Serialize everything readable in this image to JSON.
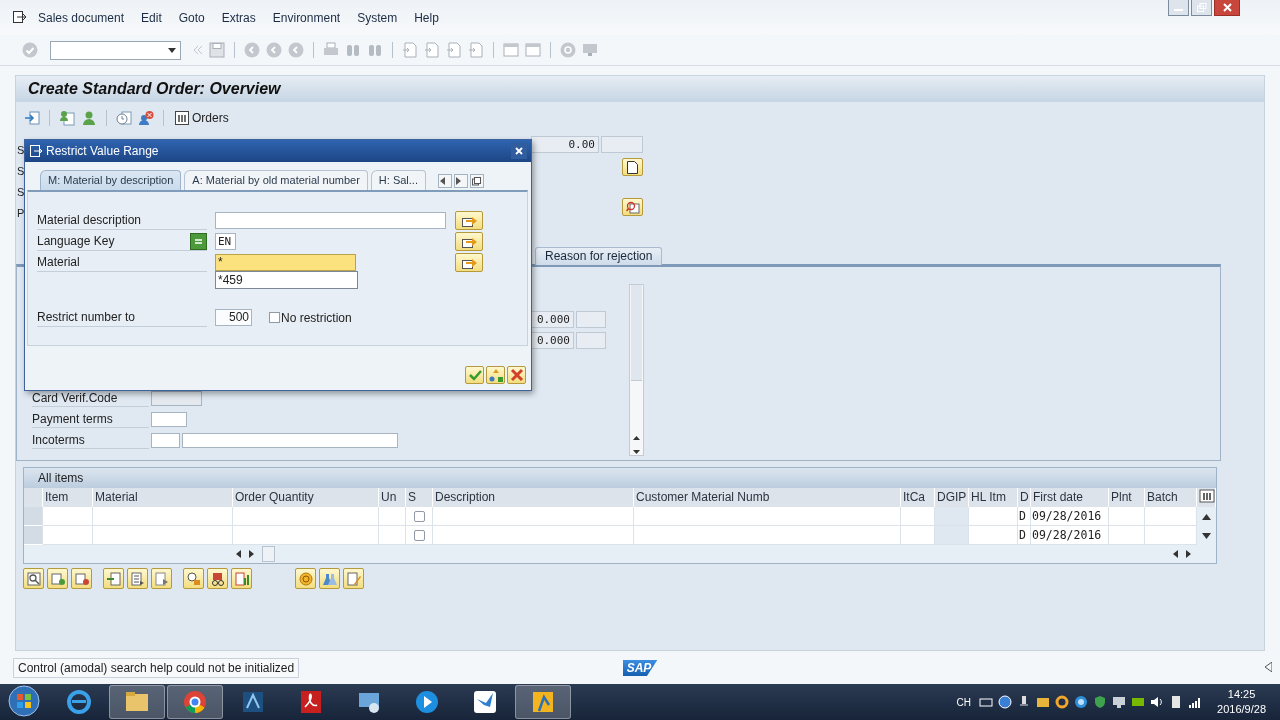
{
  "menu_bar": {
    "items": [
      {
        "label": "Sales document"
      },
      {
        "label": "Edit"
      },
      {
        "label": "Goto"
      },
      {
        "label": "Extras"
      },
      {
        "label": "Environment"
      },
      {
        "label": "System"
      },
      {
        "label": "Help"
      }
    ]
  },
  "screen": {
    "title": "Create Standard Order: Overview",
    "orders_button": "Orders"
  },
  "header": {
    "label_slivers": [
      "S",
      "S",
      "S",
      "P"
    ],
    "net_value": "0.00"
  },
  "tabs": [
    {
      "label": "Reason for rejection",
      "selected": false
    }
  ],
  "tab_panel": {
    "quantities": [
      "0.000",
      "0.000"
    ],
    "form": [
      {
        "label": "Card Verif.Code",
        "kind": "readonly"
      },
      {
        "label": "Payment terms",
        "kind": "single"
      },
      {
        "label": "Incoterms",
        "kind": "double"
      }
    ]
  },
  "items_table": {
    "title": "All items",
    "columns": [
      {
        "label": "Item",
        "kind": "text"
      },
      {
        "label": "Material",
        "kind": "text"
      },
      {
        "label": "Order Quantity",
        "kind": "text"
      },
      {
        "label": "Un",
        "kind": "text"
      },
      {
        "label": "S",
        "kind": "check"
      },
      {
        "label": "Description",
        "kind": "text"
      },
      {
        "label": "Customer Material Numb",
        "kind": "text"
      },
      {
        "label": "ItCa",
        "kind": "text"
      },
      {
        "label": "DGIP",
        "kind": "shaded"
      },
      {
        "label": "HL Itm",
        "kind": "text"
      },
      {
        "label": "D",
        "kind": "text"
      },
      {
        "label": "First date",
        "kind": "text"
      },
      {
        "label": "Plnt",
        "kind": "text"
      },
      {
        "label": "Batch",
        "kind": "text"
      }
    ],
    "rows": [
      {
        "checked": false,
        "cells": [
          "",
          "",
          "",
          "",
          "",
          "",
          "",
          "",
          "",
          "",
          "D",
          "09/28/2016",
          "",
          ""
        ]
      },
      {
        "checked": false,
        "cells": [
          "",
          "",
          "",
          "",
          "",
          "",
          "",
          "",
          "",
          "",
          "D",
          "09/28/2016",
          "",
          ""
        ]
      }
    ]
  },
  "status_bar": {
    "message": "Control (amodal) search help could not be initialized",
    "logo": "SAP"
  },
  "taskbar": {
    "language": "CH",
    "time": "14:25",
    "date": "2016/9/28"
  },
  "dialog": {
    "title": "Restrict Value Range",
    "tabs": [
      {
        "label": "M: Material by description",
        "selected": true
      },
      {
        "label": "A: Material by old material number",
        "selected": false
      },
      {
        "label": "H: Sal...",
        "selected": false
      }
    ],
    "fields": [
      {
        "label": "Material description",
        "kind": "wide"
      },
      {
        "label": "Language Key",
        "value": "EN",
        "kind": "key"
      },
      {
        "label": "Material",
        "value": "*",
        "kind": "focused"
      }
    ],
    "suggestions": [
      "*459"
    ],
    "restrict": {
      "label": "Restrict number to",
      "value": "500"
    },
    "no_restriction": {
      "label": "No restriction",
      "checked": false
    }
  }
}
